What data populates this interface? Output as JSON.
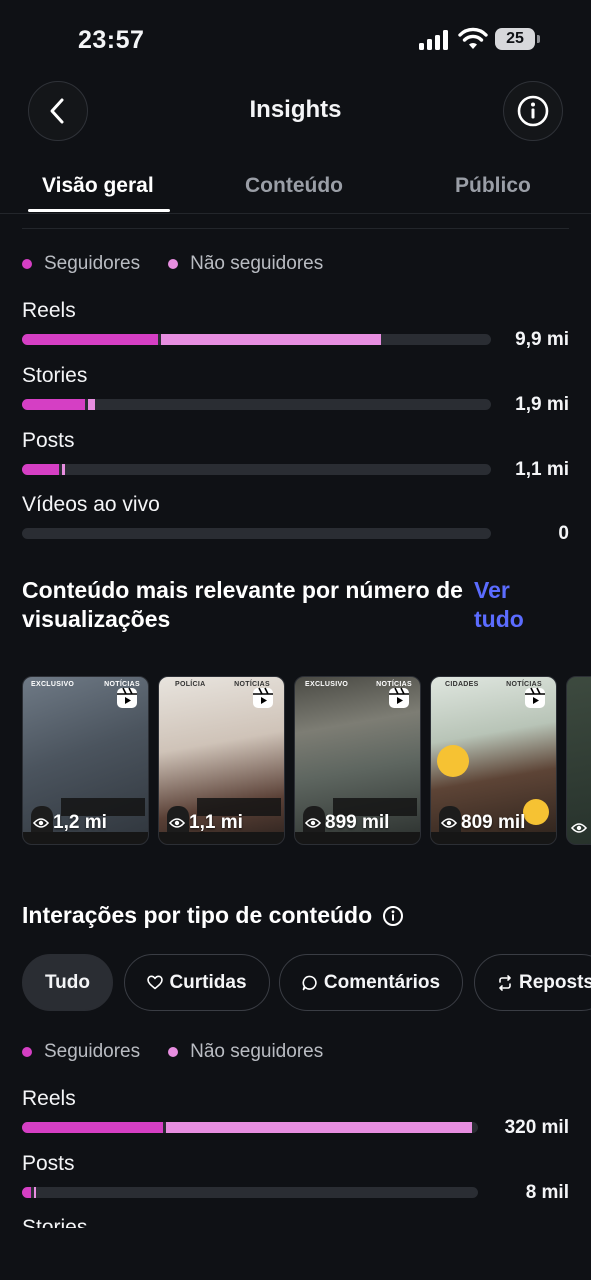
{
  "status_bar": {
    "time": "23:57",
    "battery": "25"
  },
  "header": {
    "title": "Insights"
  },
  "tabs": [
    {
      "label": "Visão geral",
      "active": true
    },
    {
      "label": "Conteúdo",
      "active": false
    },
    {
      "label": "Público",
      "active": false
    }
  ],
  "legend": {
    "followers": "Seguidores",
    "non_followers": "Não seguidores"
  },
  "colors": {
    "followers": "#d53fc4",
    "non_followers": "#e78ee0",
    "link": "#5b6cff",
    "track": "#2a2d33"
  },
  "views_by_type": {
    "scale_max": 10.4,
    "rows": [
      {
        "label": "Reels",
        "value": "9,9 mi",
        "followers_fraction": 0.29,
        "non_followers_fraction": 0.47
      },
      {
        "label": "Stories",
        "value": "1,9 mi",
        "followers_fraction": 0.135,
        "non_followers_fraction": 0.014
      },
      {
        "label": "Posts",
        "value": "1,1 mi",
        "followers_fraction": 0.078,
        "non_followers_fraction": 0.006
      },
      {
        "label": "Vídeos ao vivo",
        "value": "0",
        "followers_fraction": 0,
        "non_followers_fraction": 0
      }
    ]
  },
  "top_content": {
    "title": "Conteúdo mais relevante por número de visualizações",
    "see_all": "Ver tudo",
    "items": [
      {
        "views": "1,2 mi",
        "tag_left": "EXCLUSIVO",
        "tag_right": "NOTÍCIAS",
        "icon": "reels-icon"
      },
      {
        "views": "1,1 mi",
        "tag_left": "POLÍCIA",
        "tag_right": "NOTÍCIAS",
        "icon": "reels-icon"
      },
      {
        "views": "899 mil",
        "tag_left": "EXCLUSIVO",
        "tag_right": "NOTÍCIAS",
        "icon": "reels-icon"
      },
      {
        "views": "809 mil",
        "tag_left": "CIDADES",
        "tag_right": "NOTÍCIAS",
        "icon": "reels-icon"
      }
    ]
  },
  "interactions": {
    "title": "Interações por tipo de conteúdo",
    "filters": [
      {
        "label": "Tudo",
        "active": true
      },
      {
        "label": "Curtidas",
        "icon": "heart-icon"
      },
      {
        "label": "Comentários",
        "icon": "comment-icon"
      },
      {
        "label": "Reposts",
        "icon": "repost-icon"
      }
    ],
    "rows": [
      {
        "label": "Reels",
        "value": "320 mil",
        "followers_fraction": 0.31,
        "non_followers_fraction": 0.67
      },
      {
        "label": "Posts",
        "value": "8 mil",
        "followers_fraction": 0.02,
        "non_followers_fraction": 0.005
      },
      {
        "label": "Stories"
      }
    ]
  }
}
